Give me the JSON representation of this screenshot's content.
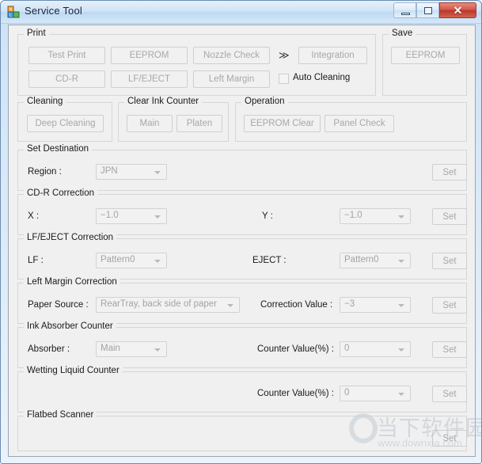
{
  "window": {
    "title": "Service Tool",
    "icon": "app-blocks-icon",
    "controls": {
      "minimize": "minimize-icon",
      "maximize": "maximize-icon",
      "close": "✕"
    }
  },
  "print_group": {
    "legend": "Print",
    "buttons": [
      {
        "label": "Test Print"
      },
      {
        "label": "EEPROM"
      },
      {
        "label": "Nozzle Check"
      },
      {
        "label": "CD-R"
      },
      {
        "label": "LF/EJECT"
      },
      {
        "label": "Left Margin"
      }
    ],
    "chevron": "≫",
    "integration_label": "Integration",
    "auto_cleaning_label": "Auto Cleaning",
    "auto_cleaning_checked": false
  },
  "save_group": {
    "legend": "Save",
    "eeprom_label": "EEPROM"
  },
  "cleaning_group": {
    "legend": "Cleaning",
    "deep_cleaning_label": "Deep Cleaning"
  },
  "clear_ink_counter_group": {
    "legend": "Clear Ink Counter",
    "main_label": "Main",
    "platen_label": "Platen"
  },
  "operation_group": {
    "legend": "Operation",
    "eeprom_clear_label": "EEPROM Clear",
    "panel_check_label": "Panel Check"
  },
  "set_destination_group": {
    "legend": "Set Destination",
    "region_label": "Region :",
    "region_value": "JPN",
    "set_label": "Set"
  },
  "cdr_correction_group": {
    "legend": "CD-R Correction",
    "x_label": "X :",
    "x_value": "−1.0",
    "y_label": "Y :",
    "y_value": "−1.0",
    "set_label": "Set"
  },
  "lf_eject_group": {
    "legend": "LF/EJECT Correction",
    "lf_label": "LF :",
    "lf_value": "Pattern0",
    "eject_label": "EJECT :",
    "eject_value": "Pattern0",
    "set_label": "Set"
  },
  "left_margin_group": {
    "legend": "Left Margin Correction",
    "paper_source_label": "Paper Source :",
    "paper_source_value": "RearTray, back side of paper",
    "correction_value_label": "Correction Value :",
    "correction_value": "−3",
    "set_label": "Set"
  },
  "ink_absorber_group": {
    "legend": "Ink Absorber Counter",
    "absorber_label": "Absorber :",
    "absorber_value": "Main",
    "counter_value_label": "Counter Value(%) :",
    "counter_value": "0",
    "set_label": "Set"
  },
  "wetting_liquid_group": {
    "legend": "Wetting Liquid Counter",
    "counter_value_label": "Counter Value(%) :",
    "counter_value": "0",
    "set_label": "Set"
  },
  "flatbed_scanner_group": {
    "legend": "Flatbed Scanner",
    "set_label": "Set"
  },
  "watermark": {
    "cn_text": "当下软件园",
    "url_text": "www.downxia.com"
  }
}
